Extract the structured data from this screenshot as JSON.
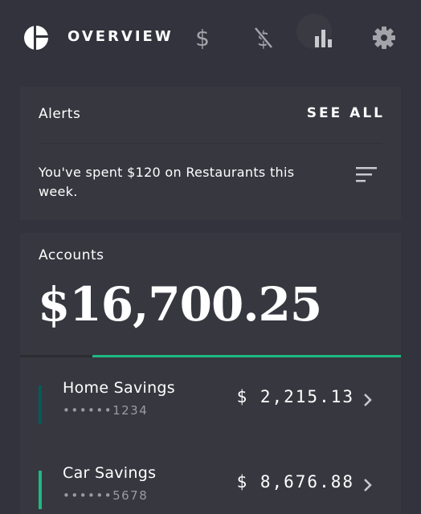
{
  "nav": {
    "title": "OVERVIEW",
    "dollar_symbol": "$",
    "icons": [
      "overview-pie-icon",
      "dollar-icon",
      "no-dollar-icon",
      "bar-chart-icon",
      "gear-icon"
    ]
  },
  "alerts": {
    "title": "Alerts",
    "see_all": "SEE ALL",
    "message": "You've spent $120 on Restaurants this week."
  },
  "accounts": {
    "title": "Accounts",
    "total": "$16,700.25",
    "progress_fraction": 0.81,
    "items": [
      {
        "name": "Home Savings",
        "number": "••••••1234",
        "amount": "$ 2,215.13",
        "color": "#005d57"
      },
      {
        "name": "Car Savings",
        "number": "••••••5678",
        "amount": "$ 8,676.88",
        "color": "#1eb980"
      }
    ]
  },
  "colors": {
    "background": "#33333d",
    "card": "#373740",
    "accent": "#1eb980",
    "dark_green": "#005d57"
  }
}
